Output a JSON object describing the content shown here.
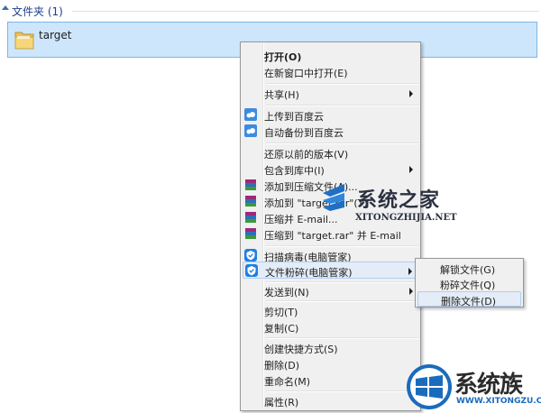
{
  "group": {
    "label": "文件夹 (1)"
  },
  "file": {
    "name": "target"
  },
  "context_menu": {
    "items": [
      {
        "label": "打开(O)"
      },
      {
        "label": "在新窗口中打开(E)"
      },
      {
        "label": "共享(H)"
      },
      {
        "label": "上传到百度云",
        "icon": "baidu-cloud-icon"
      },
      {
        "label": "自动备份到百度云",
        "icon": "baidu-cloud-icon"
      },
      {
        "label": "还原以前的版本(V)"
      },
      {
        "label": "包含到库中(I)"
      },
      {
        "label": "添加到压缩文件(A)...",
        "icon": "winrar-icon"
      },
      {
        "label": "添加到 \"target.rar\"(T)",
        "icon": "winrar-icon"
      },
      {
        "label": "压缩并 E-mail...",
        "icon": "winrar-icon"
      },
      {
        "label": "压缩到 \"target.rar\" 并 E-mail",
        "icon": "winrar-icon"
      },
      {
        "label": "扫描病毒(电脑管家)",
        "icon": "shield-icon"
      },
      {
        "label": "文件粉碎(电脑管家)",
        "icon": "shield-icon"
      },
      {
        "label": "发送到(N)"
      },
      {
        "label": "剪切(T)"
      },
      {
        "label": "复制(C)"
      },
      {
        "label": "创建快捷方式(S)"
      },
      {
        "label": "删除(D)"
      },
      {
        "label": "重命名(M)"
      },
      {
        "label": "属性(R)"
      }
    ]
  },
  "submenu": {
    "items": [
      {
        "label": "解锁文件(G)"
      },
      {
        "label": "粉碎文件(Q)"
      },
      {
        "label": "删除文件(D)"
      }
    ]
  },
  "watermark_top": {
    "title": "系统之家",
    "subtitle": "XITONGZHIJIA.NET"
  },
  "watermark_bottom": {
    "title": "系统族",
    "subtitle": "WWW.XITONGZU.COM"
  },
  "colors": {
    "selection_bg": "#cde6fb",
    "selection_border": "#7fb5e6",
    "menu_bg": "#f0f0f0",
    "hover_bg": "#e4ecf7",
    "group_text": "#1e3f8c"
  }
}
